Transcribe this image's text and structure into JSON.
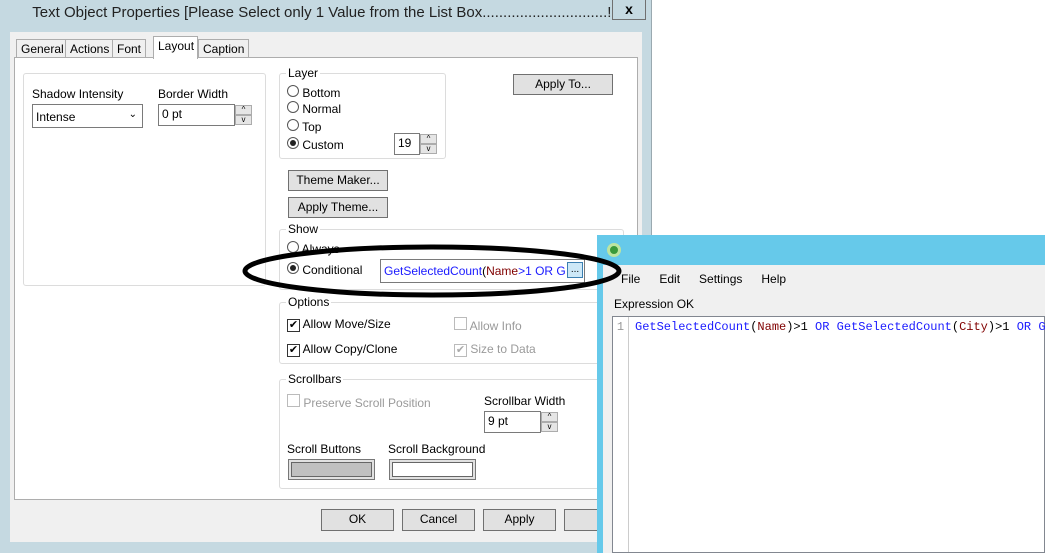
{
  "dialog": {
    "title": "Text Object Properties [Please Select only 1 Value from the List Box..............................!!]",
    "close": "x",
    "tabs": [
      "General",
      "Actions",
      "Font",
      "Layout",
      "Caption"
    ],
    "active_tab": "Layout",
    "shadow_label": "Shadow Intensity",
    "shadow_value": "Intense",
    "border_label": "Border Width",
    "border_value": "0 pt",
    "layer": {
      "label": "Layer",
      "options": [
        "Bottom",
        "Normal",
        "Top",
        "Custom"
      ],
      "selected": "Custom",
      "custom_value": "19"
    },
    "apply_to": "Apply To...",
    "theme_maker": "Theme Maker...",
    "apply_theme": "Apply Theme...",
    "show": {
      "label": "Show",
      "always": "Always",
      "conditional": "Conditional",
      "selected": "Conditional",
      "expr_func": "GetSelectedCount",
      "expr_field": "Name",
      "expr_rest": ">1 OR G",
      "browse": "..."
    },
    "options": {
      "label": "Options",
      "move": "Allow Move/Size",
      "copy": "Allow Copy/Clone",
      "info": "Allow Info",
      "size": "Size to Data"
    },
    "scrollbars": {
      "label": "Scrollbars",
      "preserve": "Preserve Scroll Position",
      "width_label": "Scrollbar Width",
      "width_value": "9 pt",
      "buttons": "Scroll Buttons",
      "background": "Scroll Background"
    },
    "buttons": {
      "ok": "OK",
      "cancel": "Cancel",
      "apply": "Apply",
      "help": "H"
    }
  },
  "editor": {
    "menu": [
      "File",
      "Edit",
      "Settings",
      "Help"
    ],
    "status": "Expression OK",
    "line": "1",
    "code": [
      {
        "t": "GetSelectedCount",
        "c": "kw"
      },
      {
        "t": "(",
        "c": ""
      },
      {
        "t": "Name",
        "c": "fld"
      },
      {
        "t": ")>1 ",
        "c": ""
      },
      {
        "t": "OR ",
        "c": "kw"
      },
      {
        "t": "GetSelectedCount",
        "c": "kw"
      },
      {
        "t": "(",
        "c": ""
      },
      {
        "t": "City",
        "c": "fld"
      },
      {
        "t": ")>1 ",
        "c": ""
      },
      {
        "t": "OR ",
        "c": "kw"
      },
      {
        "t": "Get",
        "c": "kw"
      }
    ]
  },
  "colors": {
    "popup_title": "#66c9ea",
    "keyword": "#1a1aff",
    "field": "#800000",
    "annotation": "#000000"
  }
}
